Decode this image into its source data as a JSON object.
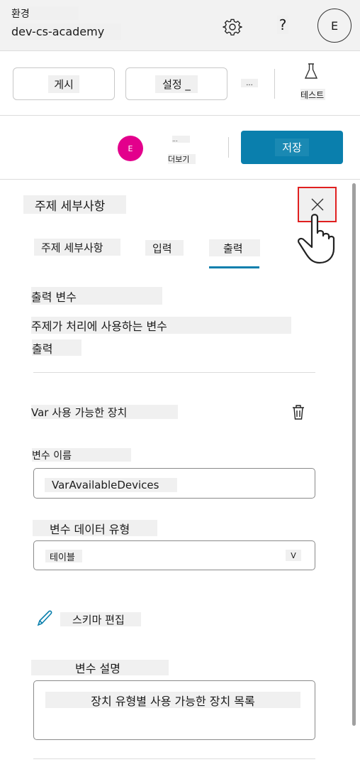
{
  "header": {
    "env_label": "환경",
    "env_name": "dev-cs-academy",
    "settings_icon": "gear-icon",
    "help_label": "?",
    "user_initial": "E"
  },
  "toolbar": {
    "publish_label": "게시",
    "settings_label": "설정 _",
    "more_label": "...",
    "test_label": "테스트"
  },
  "actions": {
    "avatar_initial": "E",
    "avatar_color": "#e3008c",
    "more_dots": "...",
    "more_label": "더보기",
    "save_label": "저장",
    "accent": "#0a7fad"
  },
  "panel": {
    "title": "주제 세부사항",
    "tabs": [
      {
        "label": "주제 세부사항",
        "active": false
      },
      {
        "label": "입력",
        "active": false
      },
      {
        "label": "출력",
        "active": true
      }
    ],
    "section_title": "출력 변수",
    "section_desc": "주제가 처리에 사용하는 변수",
    "section_sub": "출력",
    "variable": {
      "title": "Var 사용 가능한 장치",
      "name_label": "변수 이름",
      "name_value": "VarAvailableDevices",
      "type_label": "변수 데이터 유형",
      "type_value": "테이블",
      "type_chevron": "V",
      "edit_schema_label": "스키마 편집",
      "desc_label": "변수 설명",
      "desc_value": "장치 유형별 사용 가능한 장치 목록"
    }
  }
}
